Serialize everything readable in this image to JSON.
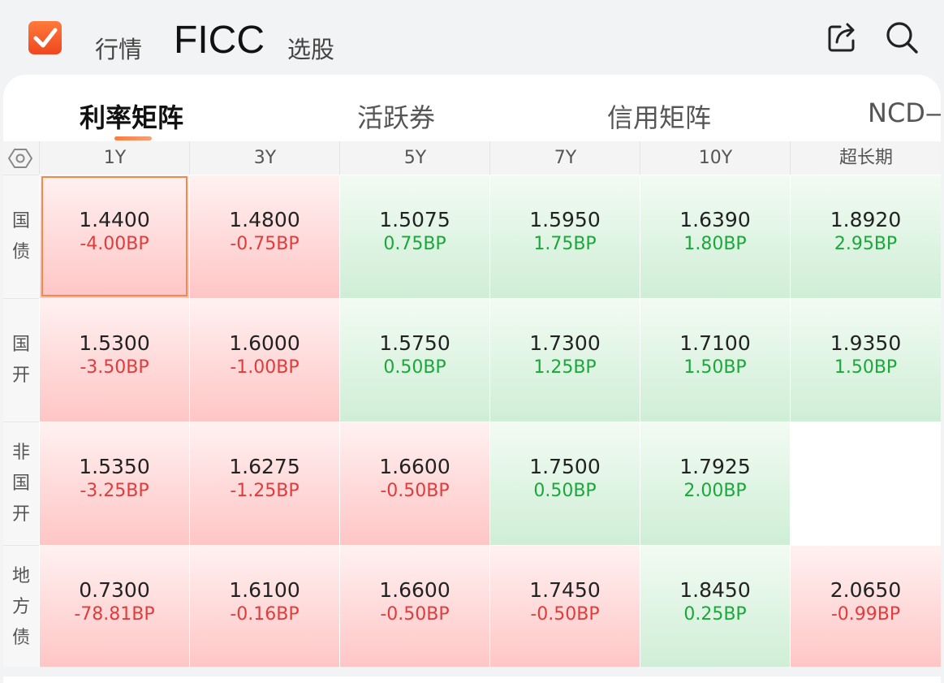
{
  "colors": {
    "accent": "#f0461f",
    "up": "#e23b3b",
    "down": "#1aa83a"
  },
  "topbar": {
    "logo_icon": "check-square-icon",
    "tabs": [
      "行情",
      "FICC",
      "选股"
    ],
    "active_tab": "FICC",
    "share_icon": "share-icon",
    "search_icon": "search-icon"
  },
  "subtabs": [
    "利率矩阵",
    "活跃券",
    "信用矩阵",
    "NCD"
  ],
  "active_subtab": "利率矩阵",
  "matrix": {
    "settings_icon": "hexagon-settings-icon",
    "columns": [
      "1Y",
      "3Y",
      "5Y",
      "7Y",
      "10Y",
      "超长期"
    ],
    "rows": [
      {
        "label": "国债",
        "label_chars": [
          "国",
          "债"
        ],
        "cells": [
          {
            "value": "1.4400",
            "change": "-4.00BP",
            "trend": "down"
          },
          {
            "value": "1.4800",
            "change": "-0.75BP",
            "trend": "down"
          },
          {
            "value": "1.5075",
            "change": "0.75BP",
            "trend": "up"
          },
          {
            "value": "1.5950",
            "change": "1.75BP",
            "trend": "up"
          },
          {
            "value": "1.6390",
            "change": "1.80BP",
            "trend": "up"
          },
          {
            "value": "1.8920",
            "change": "2.95BP",
            "trend": "up"
          }
        ]
      },
      {
        "label": "国开",
        "label_chars": [
          "国",
          "开"
        ],
        "cells": [
          {
            "value": "1.5300",
            "change": "-3.50BP",
            "trend": "down"
          },
          {
            "value": "1.6000",
            "change": "-1.00BP",
            "trend": "down"
          },
          {
            "value": "1.5750",
            "change": "0.50BP",
            "trend": "up"
          },
          {
            "value": "1.7300",
            "change": "1.25BP",
            "trend": "up"
          },
          {
            "value": "1.7100",
            "change": "1.50BP",
            "trend": "up"
          },
          {
            "value": "1.9350",
            "change": "1.50BP",
            "trend": "up"
          }
        ]
      },
      {
        "label": "非国开",
        "label_chars": [
          "非",
          "国",
          "开"
        ],
        "cells": [
          {
            "value": "1.5350",
            "change": "-3.25BP",
            "trend": "down"
          },
          {
            "value": "1.6275",
            "change": "-1.25BP",
            "trend": "down"
          },
          {
            "value": "1.6600",
            "change": "-0.50BP",
            "trend": "down"
          },
          {
            "value": "1.7500",
            "change": "0.50BP",
            "trend": "up"
          },
          {
            "value": "1.7925",
            "change": "2.00BP",
            "trend": "up"
          },
          {
            "value": "",
            "change": "",
            "trend": "none"
          }
        ]
      },
      {
        "label": "地方债",
        "label_chars": [
          "地",
          "方",
          "债"
        ],
        "cells": [
          {
            "value": "0.7300",
            "change": "-78.81BP",
            "trend": "down"
          },
          {
            "value": "1.6100",
            "change": "-0.16BP",
            "trend": "down"
          },
          {
            "value": "1.6600",
            "change": "-0.50BP",
            "trend": "down"
          },
          {
            "value": "1.7450",
            "change": "-0.50BP",
            "trend": "down"
          },
          {
            "value": "1.8450",
            "change": "0.25BP",
            "trend": "up"
          },
          {
            "value": "2.0650",
            "change": "-0.99BP",
            "trend": "down"
          }
        ]
      }
    ]
  }
}
